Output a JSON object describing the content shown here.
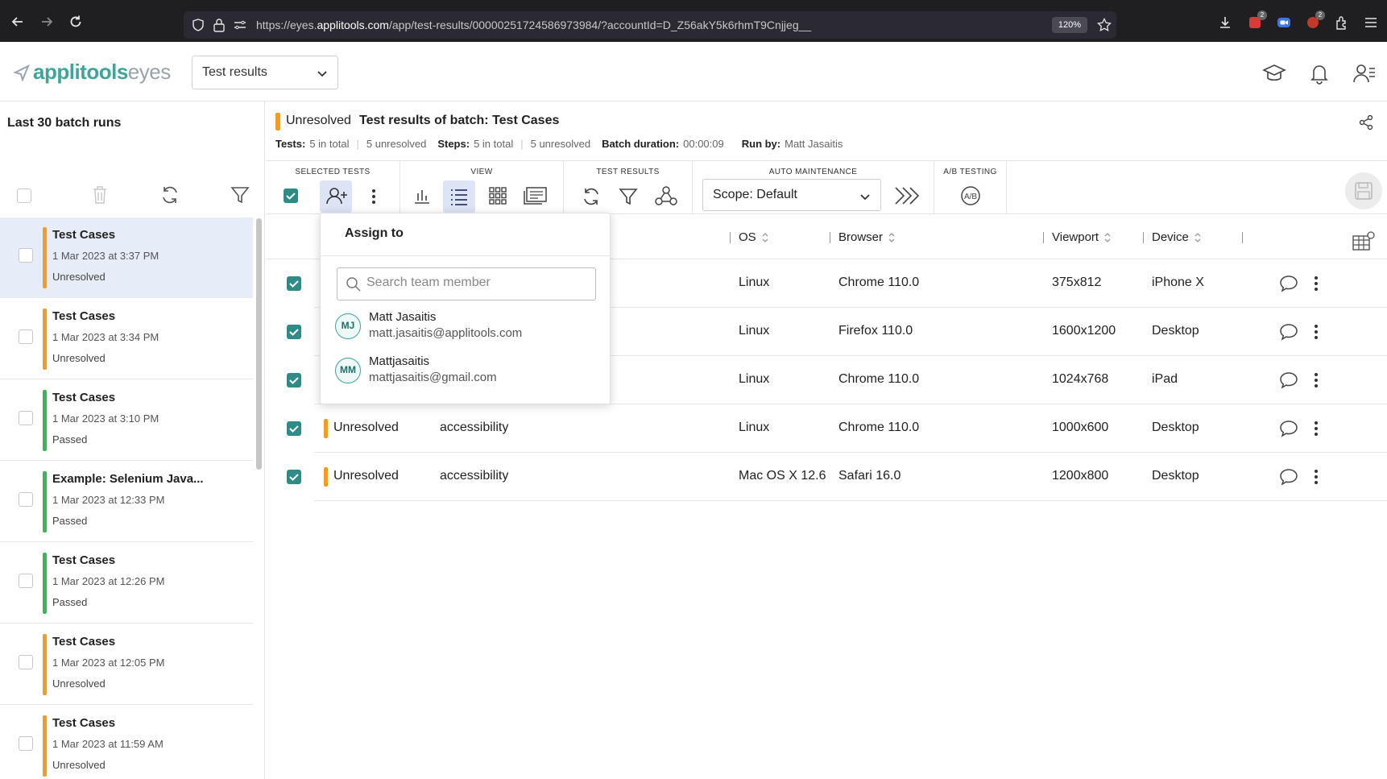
{
  "browser": {
    "url_prefix": "https://eyes.",
    "url_domain": "applitools.com",
    "url_path": "/app/test-results/00000251724586973984/?accountId=D_Z56akY5k6rhmT9Cnjjeg__",
    "zoom": "120%",
    "ext_badge_1": "2",
    "ext_badge_2": "2"
  },
  "header": {
    "logo_part1": "applitools",
    "logo_part2": "eyes",
    "page_select_value": "Test results"
  },
  "sidebar": {
    "title": "Last 30 batch runs",
    "batches": [
      {
        "name": "Test Cases",
        "date": "1 Mar 2023 at 3:37 PM",
        "status": "Unresolved",
        "color": "#f39c1f",
        "selected": true
      },
      {
        "name": "Test Cases",
        "date": "1 Mar 2023 at 3:34 PM",
        "status": "Unresolved",
        "color": "#f39c1f",
        "selected": false
      },
      {
        "name": "Test Cases",
        "date": "1 Mar 2023 at 3:10 PM",
        "status": "Passed",
        "color": "#3cb558",
        "selected": false
      },
      {
        "name": "Example: Selenium Java...",
        "date": "1 Mar 2023 at 12:33 PM",
        "status": "Passed",
        "color": "#3cb558",
        "selected": false
      },
      {
        "name": "Test Cases",
        "date": "1 Mar 2023 at 12:26 PM",
        "status": "Passed",
        "color": "#3cb558",
        "selected": false
      },
      {
        "name": "Test Cases",
        "date": "1 Mar 2023 at 12:05 PM",
        "status": "Unresolved",
        "color": "#f39c1f",
        "selected": false
      },
      {
        "name": "Test Cases",
        "date": "1 Mar 2023 at 11:59 AM",
        "status": "Unresolved",
        "color": "#f39c1f",
        "selected": false
      }
    ]
  },
  "batch": {
    "status": "Unresolved",
    "title": "Test results of batch: Test Cases",
    "tests_label": "Tests:",
    "tests_total": "5 in total",
    "tests_unresolved": "5 unresolved",
    "steps_label": "Steps:",
    "steps_total": "5 in total",
    "steps_unresolved": "5 unresolved",
    "duration_label": "Batch duration:",
    "duration": "00:00:09",
    "runby_label": "Run by:",
    "runby": "Matt Jasaitis"
  },
  "toolbar": {
    "selected_tests": "SELECTED TESTS",
    "view": "VIEW",
    "test_results": "TEST RESULTS",
    "auto_maintenance": "AUTO MAINTENANCE",
    "ab_testing": "A/B TESTING",
    "scope_value": "Scope: Default"
  },
  "table": {
    "headers": {
      "os": "OS",
      "browser": "Browser",
      "viewport": "Viewport",
      "device": "Device"
    },
    "rows": [
      {
        "status": "",
        "name": "",
        "os": "Linux",
        "browser": "Chrome 110.0",
        "viewport": "375x812",
        "device": "iPhone X"
      },
      {
        "status": "",
        "name": "",
        "os": "Linux",
        "browser": "Firefox 110.0",
        "viewport": "1600x1200",
        "device": "Desktop"
      },
      {
        "status": "",
        "name": "",
        "os": "Linux",
        "browser": "Chrome 110.0",
        "viewport": "1024x768",
        "device": "iPad"
      },
      {
        "status": "Unresolved",
        "name": "accessibility",
        "os": "Linux",
        "browser": "Chrome 110.0",
        "viewport": "1000x600",
        "device": "Desktop"
      },
      {
        "status": "Unresolved",
        "name": "accessibility",
        "os": "Mac OS X 12.6",
        "browser": "Safari 16.0",
        "viewport": "1200x800",
        "device": "Desktop"
      }
    ]
  },
  "assign": {
    "title": "Assign to",
    "search_placeholder": "Search team member",
    "members": [
      {
        "initials": "MJ",
        "name": "Matt Jasaitis",
        "email": "matt.jasaitis@applitools.com"
      },
      {
        "initials": "MM",
        "name": "Mattjasaitis",
        "email": "mattjasaitis@gmail.com"
      }
    ]
  },
  "colors": {
    "accent": "#3fa59a",
    "unresolved": "#f39c1f",
    "passed": "#3cb558",
    "checkbox": "#2e8b86"
  }
}
